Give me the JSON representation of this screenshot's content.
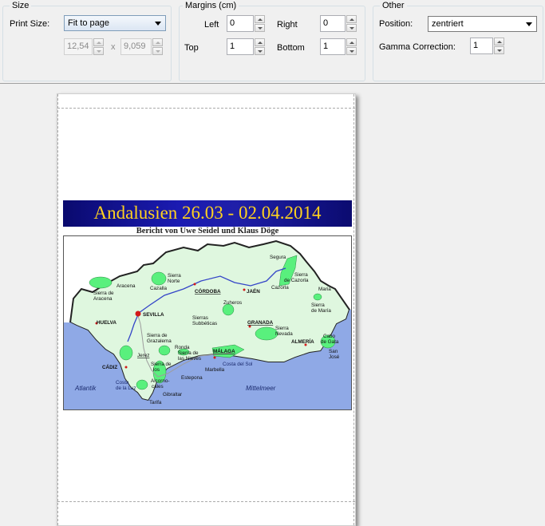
{
  "size_group": {
    "title": "Size",
    "print_size_label": "Print Size:",
    "print_size_value": "Fit to page",
    "width_value": "12,54",
    "times_sign": "x",
    "height_value": "9,059"
  },
  "margins_group": {
    "title": "Margins (cm)",
    "left_label": "Left",
    "left_value": "0",
    "right_label": "Right",
    "right_value": "0",
    "top_label": "Top",
    "top_value": "1",
    "bottom_label": "Bottom",
    "bottom_value": "1"
  },
  "other_group": {
    "title": "Other",
    "position_label": "Position:",
    "position_value": "zentriert",
    "gamma_label": "Gamma Correction:",
    "gamma_value": "1"
  },
  "preview": {
    "banner_title": "Andalusien 26.03 - 02.04.2014",
    "subtitle": "Bericht von Uwe Seidel und Klaus Döge",
    "map_labels": {
      "segura": "Segura",
      "sierra_norte_1": "Sierra",
      "sierra_norte_2": "Norte",
      "aracena": "Aracena",
      "sierra_de_aracena_1": "Sierra de",
      "sierra_de_aracena_2": "Aracena",
      "cazalla": "Cazalla",
      "cordoba": "CÓRDOBA",
      "jaen": "JAÉN",
      "sierra_cazorla_1": "Sierra",
      "sierra_cazorla_2": "de Cazorla",
      "cazorla": "Cazorla",
      "maria": "Maria",
      "sierra_de_maria_1": "Sierra",
      "sierra_de_maria_2": "de María",
      "zuheros": "Zuheros",
      "sevilla": "SEVILLA",
      "huelva": "HUELVA",
      "sierras_subbeticas_1": "Sierras",
      "sierras_subbeticas_2": "Subbéticas",
      "granada": "GRANADA",
      "sierra_nevada_1": "Sierra",
      "sierra_nevada_2": "Nevada",
      "almeria": "ALMERÍA",
      "cabo_de_gata_1": "Cabo",
      "cabo_de_gata_2": "de Gata",
      "san_jose_1": "San",
      "san_jose_2": "José",
      "sierra_de_grazalema_1": "Sierra de",
      "sierra_de_grazalema_2": "Grazalema",
      "ronda": "Ronda",
      "sierra_de_las_nieves_1": "Sierra de",
      "sierra_de_las_nieves_2": "las Nieves",
      "malaga": "MÁLAGA",
      "jerez": "Jerez",
      "cadiz": "CÁDIZ",
      "estepona": "Estepona",
      "marbella": "Marbella",
      "costa_del_sol_1": "Costa del Sol",
      "costa_de_la_luz_1": "Costa",
      "costa_de_la_luz_2": "de la Luz",
      "los_alcornocales_1": "Sierra de",
      "los_alcornocales_2": "los",
      "los_alcornocales_3": "Alcorno-",
      "los_alcornocales_4": "cales",
      "gibraltar": "Gibraltar",
      "tarifa": "Tarifa",
      "atlantik": "Atlantik",
      "mittelmeer": "Mittelmeer"
    }
  }
}
